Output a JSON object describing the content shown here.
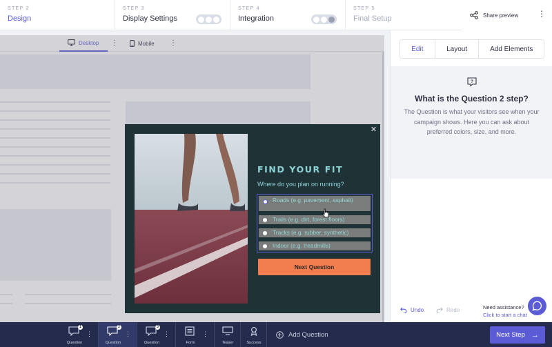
{
  "steps": [
    {
      "number": "STEP 2",
      "title": "Design",
      "state": "active"
    },
    {
      "number": "STEP 3",
      "title": "Display Settings",
      "state": "normal"
    },
    {
      "number": "STEP 4",
      "title": "Integration",
      "state": "normal"
    },
    {
      "number": "STEP 5",
      "title": "Final Setup",
      "state": "disabled"
    }
  ],
  "header": {
    "share_label": "Share preview"
  },
  "canvas": {
    "device_tabs": [
      {
        "label": "Desktop",
        "icon": "monitor-icon",
        "active": true
      },
      {
        "label": "Mobile",
        "icon": "phone-icon",
        "active": false
      }
    ]
  },
  "popup": {
    "title": "FIND YOUR FIT",
    "subtitle": "Where do you plan on running?",
    "options": [
      {
        "label": "Roads (e.g. pavement, asphalt)",
        "selected": true
      },
      {
        "label": "Trails (e.g. dirt, forest floors)",
        "selected": false
      },
      {
        "label": "Tracks (e.g. rubber, synthetic)",
        "selected": false
      },
      {
        "label": "Indoor (e.g. treadmills)",
        "selected": false
      }
    ],
    "button": "Next Question"
  },
  "panel": {
    "tabs": [
      "Edit",
      "Layout",
      "Add Elements"
    ],
    "active_tab": "Edit",
    "info_title": "What is the Question 2 step?",
    "info_text": "The Question is what your visitors see when your campaign shows. Here you can ask about preferred colors, size, and more.",
    "undo": "Undo",
    "redo": "Redo",
    "assist_title": "Need assistance?",
    "assist_link": "Click to start a chat"
  },
  "bottom": {
    "steps": [
      {
        "label": "Question",
        "badge": "1",
        "active": false
      },
      {
        "label": "Question",
        "badge": "2",
        "active": true
      },
      {
        "label": "Question",
        "badge": "3",
        "active": false
      },
      {
        "label": "Form",
        "badge": "",
        "active": false
      },
      {
        "label": "Teaser",
        "badge": "",
        "active": false
      },
      {
        "label": "Success",
        "badge": "",
        "active": false
      }
    ],
    "add_question": "Add Question",
    "next_step": "Next Step"
  },
  "colors": {
    "accent": "#5b5bd6",
    "popup_bg": "#1f3337",
    "popup_text": "#8fd2d6",
    "cta": "#f27d4e",
    "bottom_bg": "#242b4d"
  }
}
